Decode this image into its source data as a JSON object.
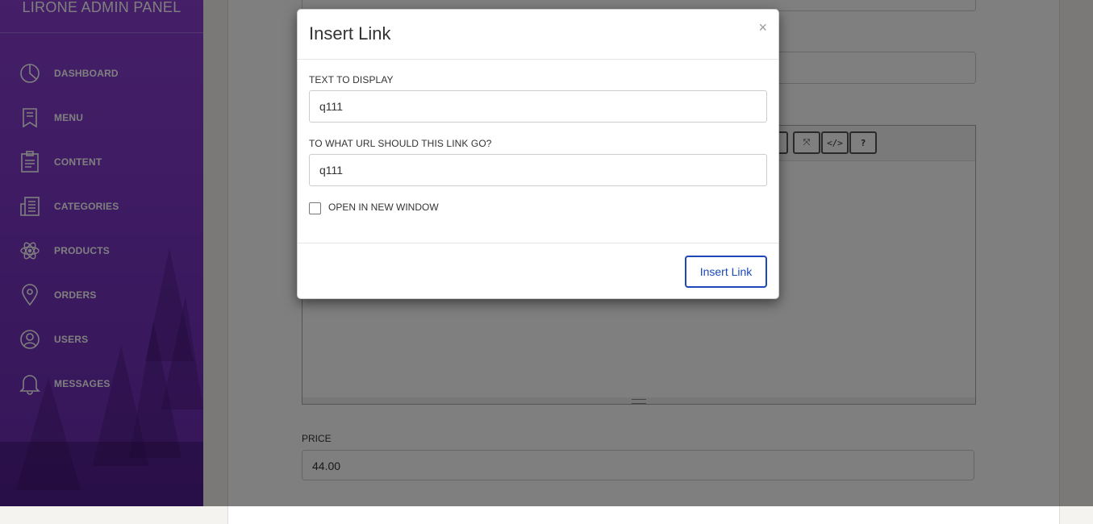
{
  "sidebar": {
    "brand": "LIRONE ADMIN PANEL",
    "items": [
      {
        "label": "DASHBOARD",
        "icon": "pie-chart-icon"
      },
      {
        "label": "MENU",
        "icon": "bookmark-icon"
      },
      {
        "label": "CONTENT",
        "icon": "clipboard-icon"
      },
      {
        "label": "CATEGORIES",
        "icon": "newspaper-icon"
      },
      {
        "label": "PRODUCTS",
        "icon": "atom-icon"
      },
      {
        "label": "ORDERS",
        "icon": "map-pin-icon"
      },
      {
        "label": "USERS",
        "icon": "user-icon"
      },
      {
        "label": "MESSAGES",
        "icon": "bell-icon"
      }
    ]
  },
  "editor": {
    "toolbar": [
      {
        "label": "⤧",
        "icon": "fullscreen-icon"
      },
      {
        "label": "</>",
        "icon": "code-view-icon"
      },
      {
        "label": "?",
        "icon": "help-icon"
      }
    ]
  },
  "price": {
    "label": "PRICE",
    "value": "44.00"
  },
  "modal": {
    "title": "Insert Link",
    "close": "×",
    "text_label": "TEXT TO DISPLAY",
    "text_value": "q111",
    "url_label": "TO WHAT URL SHOULD THIS LINK GO?",
    "url_value": "q111",
    "new_window_label": "OPEN IN NEW WINDOW",
    "new_window_checked": false,
    "submit_label": "Insert Link"
  }
}
